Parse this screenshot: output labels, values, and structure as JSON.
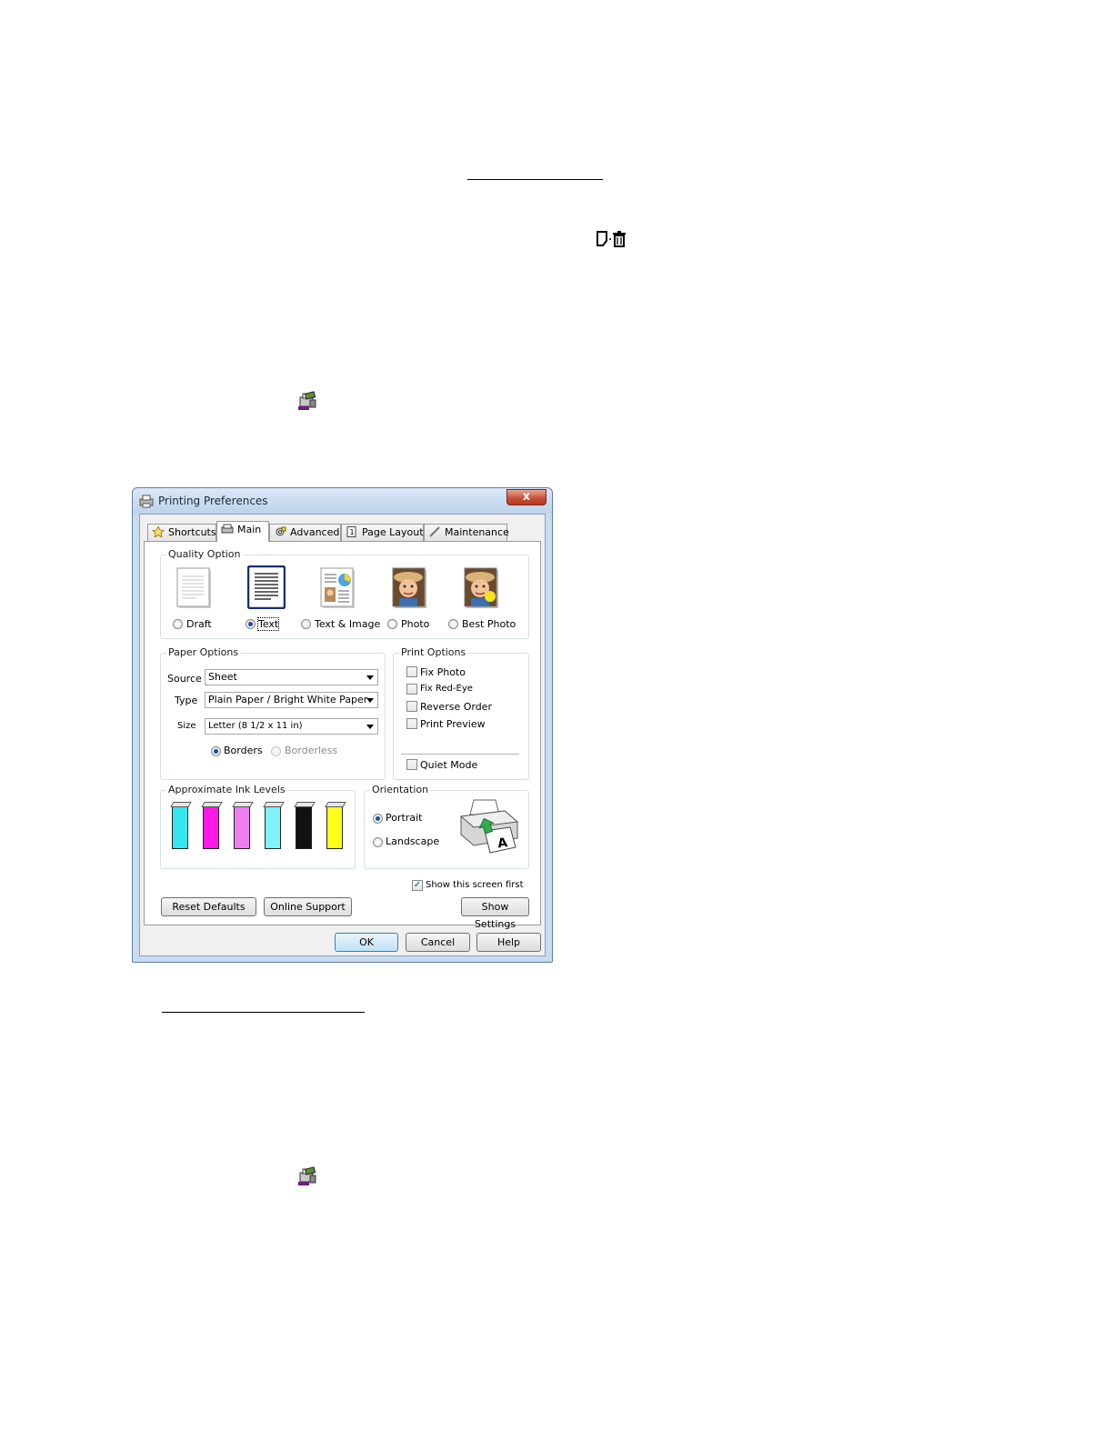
{
  "dialog": {
    "title": "Printing Preferences",
    "close_label": "x",
    "tabs": [
      {
        "label": "Shortcuts",
        "icon": "star-icon"
      },
      {
        "label": "Main",
        "icon": "printer-icon"
      },
      {
        "label": "Advanced",
        "icon": "gear-icon"
      },
      {
        "label": "Page Layout",
        "icon": "page-icon"
      },
      {
        "label": "Maintenance",
        "icon": "wrench-icon"
      }
    ],
    "quality_option": {
      "title": "Quality Option",
      "options": [
        "Draft",
        "Text",
        "Text & Image",
        "Photo",
        "Best Photo"
      ],
      "selected": "Text"
    },
    "paper_options": {
      "title": "Paper Options",
      "source_label": "Source",
      "source_value": "Sheet",
      "type_label": "Type",
      "type_value": "Plain Paper / Bright White Paper",
      "size_label": "Size",
      "size_value": "Letter (8 1/2 x 11 in)",
      "borders_label": "Borders",
      "borderless_label": "Borderless"
    },
    "print_options": {
      "title": "Print Options",
      "items": [
        "Fix Photo",
        "Fix Red-Eye",
        "Reverse Order",
        "Print Preview"
      ],
      "quiet_mode": "Quiet Mode"
    },
    "ink_levels": {
      "title": "Approximate Ink Levels",
      "colors": [
        "#35e6f0",
        "#ff19e8",
        "#f07ef0",
        "#7ff4f8",
        "#111111",
        "#ffff1a"
      ]
    },
    "orientation": {
      "title": "Orientation",
      "portrait": "Portrait",
      "landscape": "Landscape"
    },
    "show_first": "Show this screen first",
    "buttons": {
      "reset": "Reset Defaults",
      "online": "Online Support",
      "show_settings": "Show Settings",
      "ok": "OK",
      "cancel": "Cancel",
      "help": "Help"
    }
  }
}
